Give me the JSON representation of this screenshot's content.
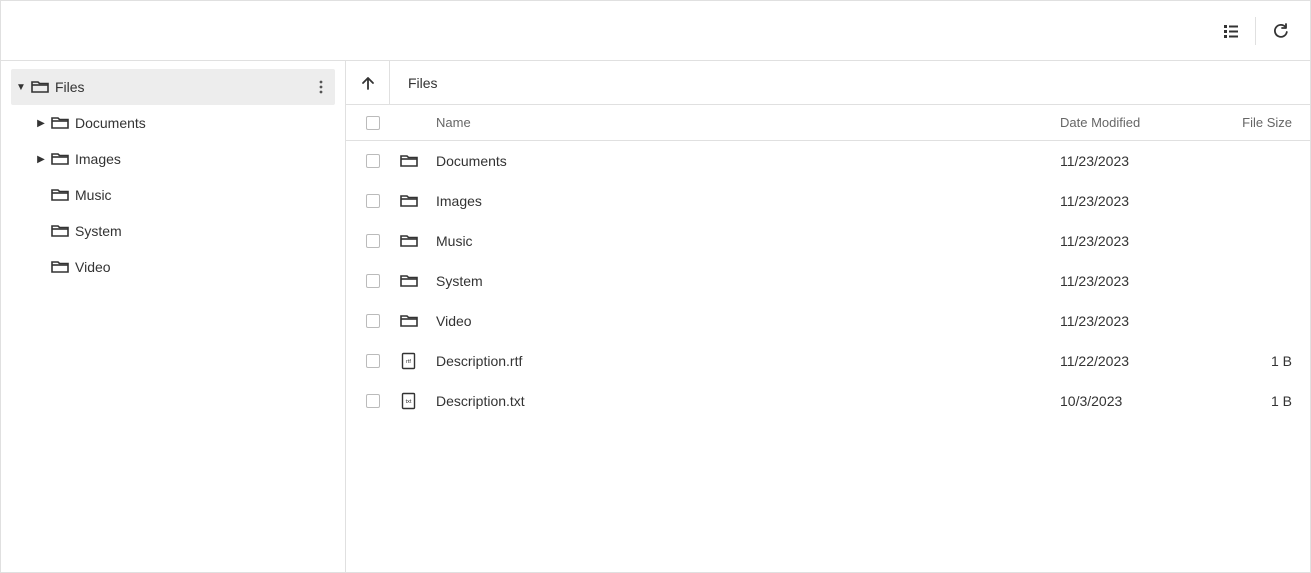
{
  "toolbar": {
    "view_icon": "details-view",
    "refresh_icon": "refresh"
  },
  "breadcrumb": {
    "current": "Files"
  },
  "tree": {
    "root": {
      "label": "Files",
      "expanded": true,
      "selected": true
    },
    "children": [
      {
        "label": "Documents",
        "hasChildren": true
      },
      {
        "label": "Images",
        "hasChildren": true
      },
      {
        "label": "Music",
        "hasChildren": false
      },
      {
        "label": "System",
        "hasChildren": false
      },
      {
        "label": "Video",
        "hasChildren": false
      }
    ]
  },
  "columns": {
    "name": "Name",
    "date": "Date Modified",
    "size": "File Size"
  },
  "items": [
    {
      "type": "folder",
      "name": "Documents",
      "date": "11/23/2023",
      "size": ""
    },
    {
      "type": "folder",
      "name": "Images",
      "date": "11/23/2023",
      "size": ""
    },
    {
      "type": "folder",
      "name": "Music",
      "date": "11/23/2023",
      "size": ""
    },
    {
      "type": "folder",
      "name": "System",
      "date": "11/23/2023",
      "size": ""
    },
    {
      "type": "folder",
      "name": "Video",
      "date": "11/23/2023",
      "size": ""
    },
    {
      "type": "rtf",
      "name": "Description.rtf",
      "date": "11/22/2023",
      "size": "1 B"
    },
    {
      "type": "txt",
      "name": "Description.txt",
      "date": "10/3/2023",
      "size": "1 B"
    }
  ]
}
